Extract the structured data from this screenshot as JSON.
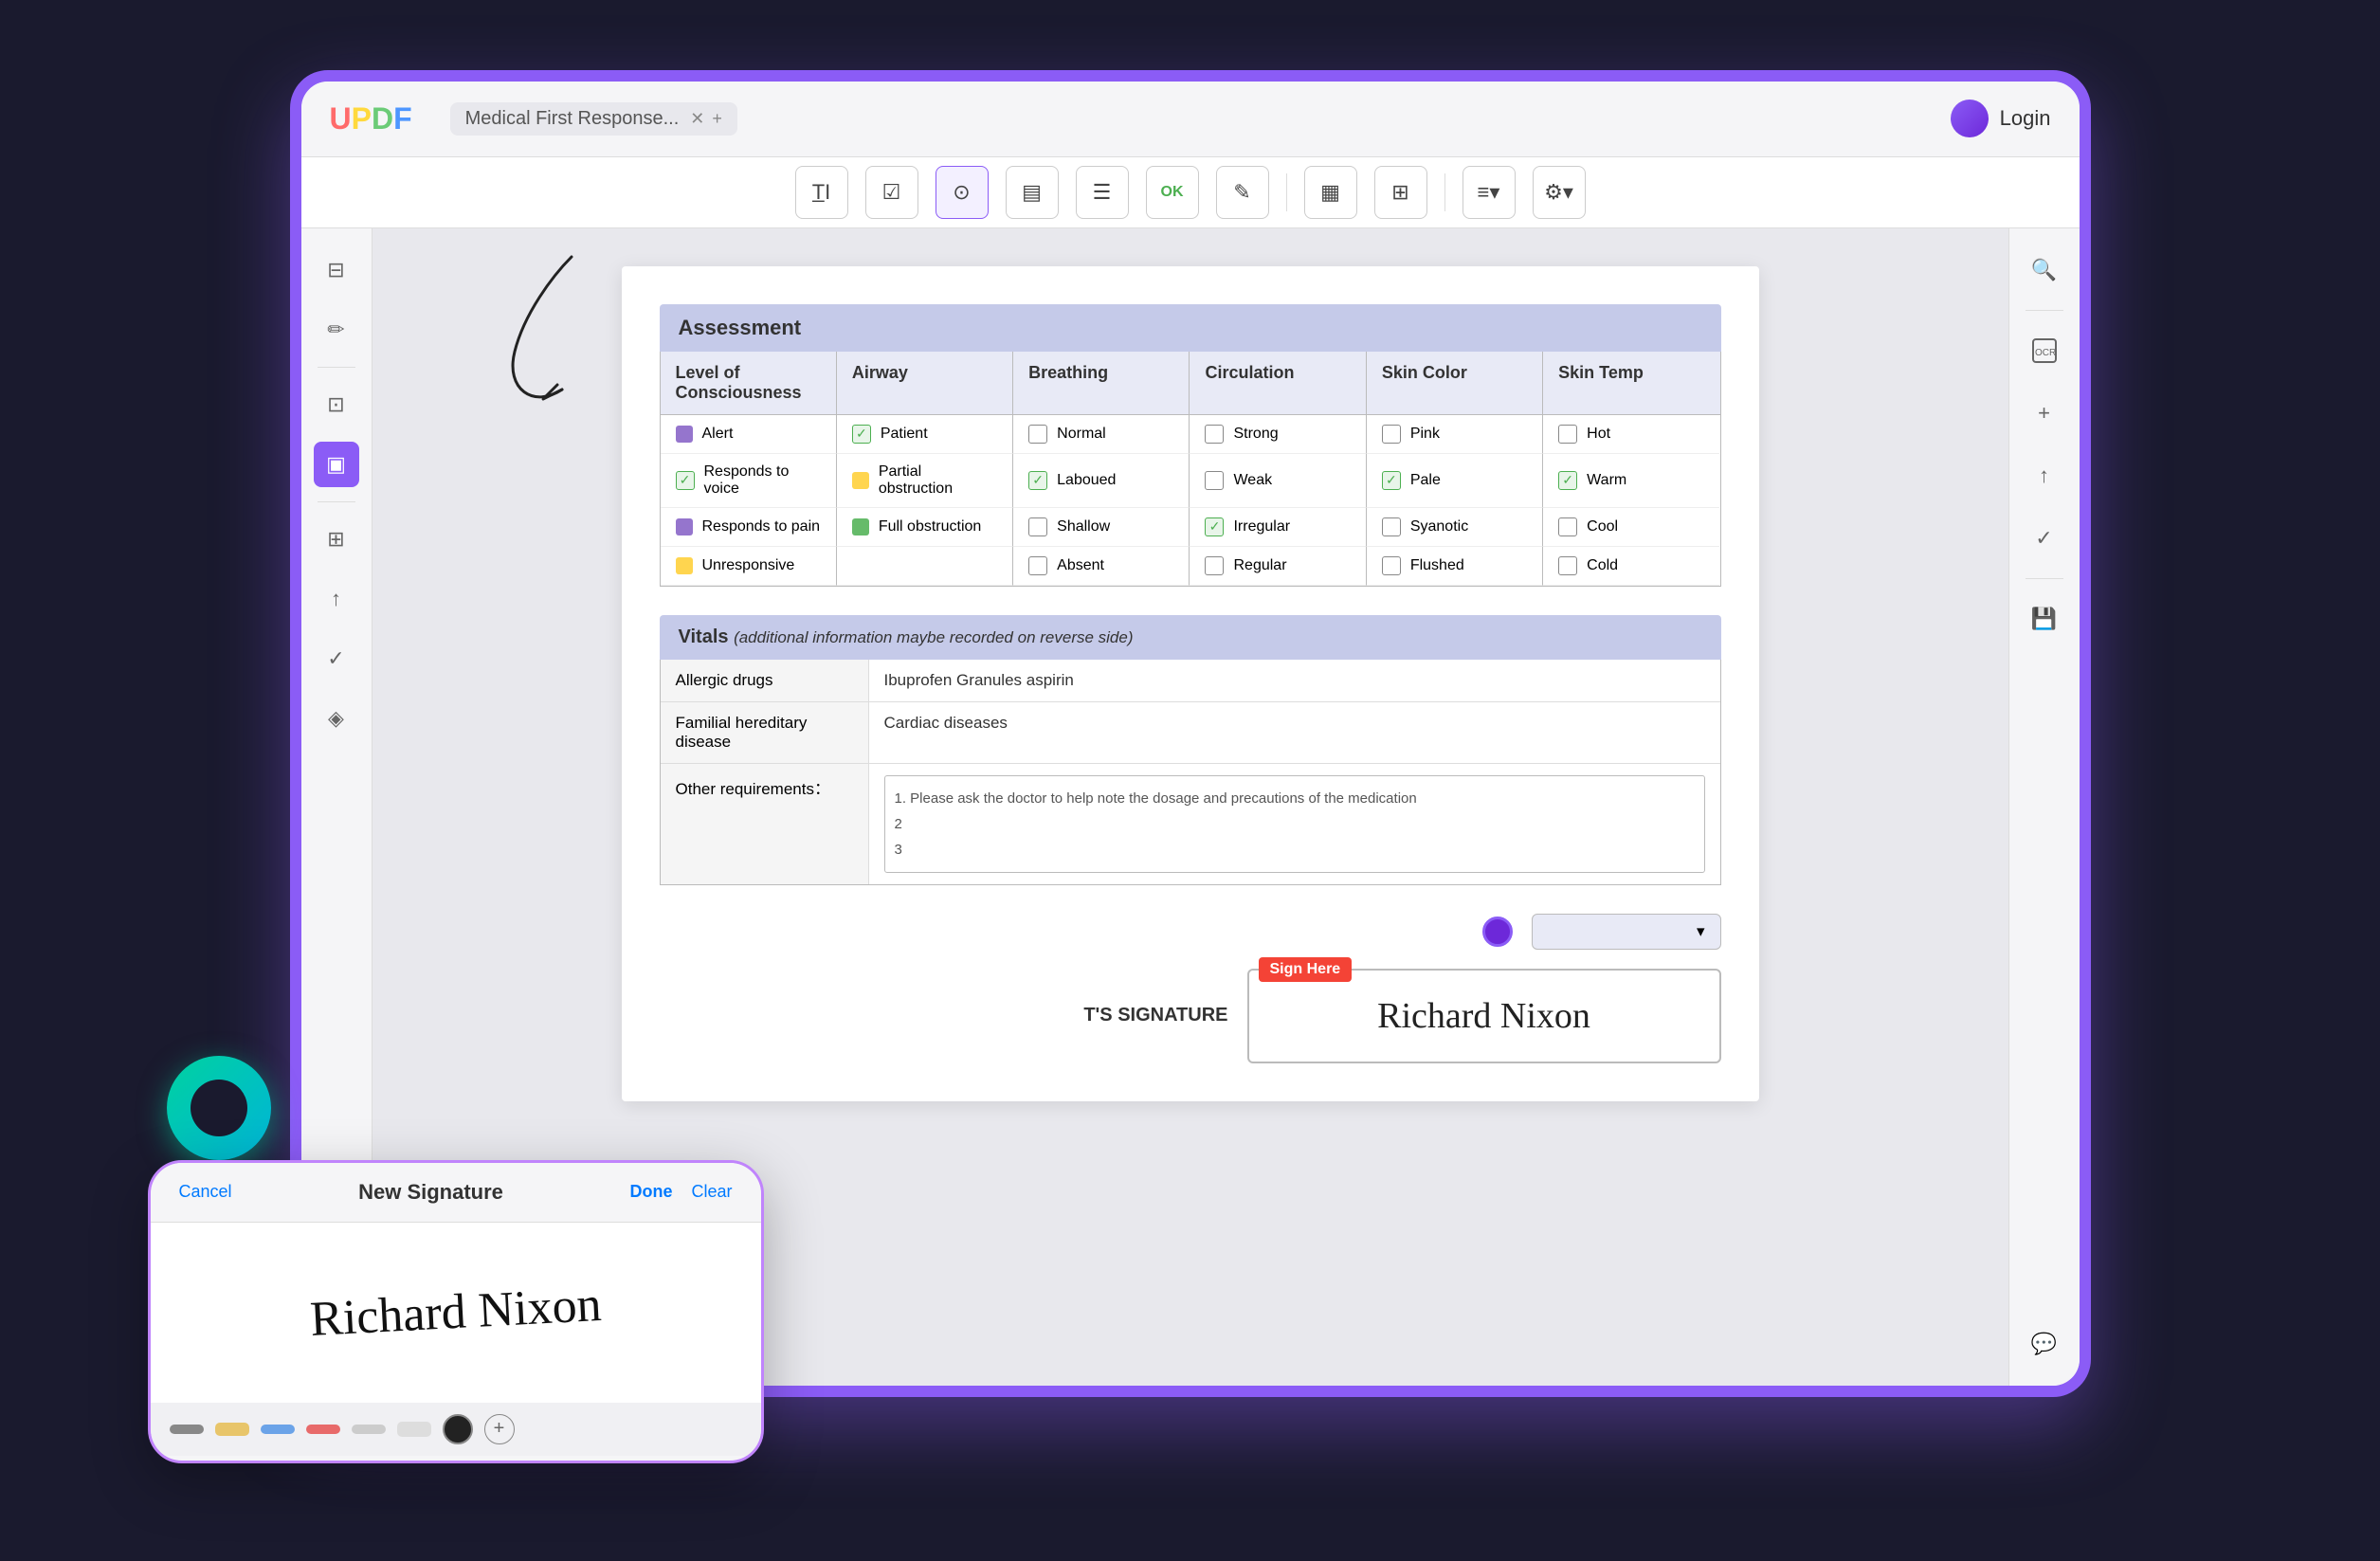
{
  "app": {
    "logo": "UPDF",
    "logo_letters": [
      "U",
      "P",
      "D",
      "F"
    ],
    "tab_title": "Medical First Response...",
    "login_label": "Login"
  },
  "toolbar": {
    "tools": [
      {
        "name": "text-field",
        "icon": "T̲I"
      },
      {
        "name": "checkbox-tool",
        "icon": "☑"
      },
      {
        "name": "radio-tool",
        "icon": "⊙"
      },
      {
        "name": "text-area",
        "icon": "▤"
      },
      {
        "name": "list-tool",
        "icon": "☰"
      },
      {
        "name": "ok-stamp",
        "icon": "OK"
      },
      {
        "name": "signature-tool",
        "icon": "✎"
      },
      {
        "name": "image-tool",
        "icon": "▦"
      },
      {
        "name": "grid-tool",
        "icon": "⊞"
      },
      {
        "name": "align-tool",
        "icon": "≡"
      },
      {
        "name": "settings-tool",
        "icon": "⚙"
      }
    ]
  },
  "sidebar": {
    "icons": [
      {
        "name": "pages",
        "icon": "⊟"
      },
      {
        "name": "edit",
        "icon": "✏"
      },
      {
        "name": "comment",
        "icon": "⊡"
      },
      {
        "name": "form",
        "icon": "▣"
      },
      {
        "name": "organize",
        "icon": "⊞"
      },
      {
        "name": "export",
        "icon": "↑"
      },
      {
        "name": "protect",
        "icon": "✓"
      },
      {
        "name": "watermark",
        "icon": "◈"
      }
    ]
  },
  "assessment": {
    "header": "Assessment",
    "columns": [
      "Level of Consciousness",
      "Airway",
      "Breathing",
      "Circulation",
      "Skin Color",
      "Skin Temp"
    ],
    "rows": [
      {
        "consciousness": {
          "label": "Alert",
          "checked": false,
          "color": "purple"
        },
        "airway": {
          "label": "Patient",
          "checked": true,
          "color": "green"
        },
        "breathing": {
          "label": "Normal",
          "checked": false
        },
        "circulation": {
          "label": "Strong",
          "checked": false
        },
        "skin_color": {
          "label": "Pink",
          "checked": false
        },
        "skin_temp": {
          "label": "Hot",
          "checked": false
        }
      },
      {
        "consciousness": {
          "label": "Responds to voice",
          "checked": true,
          "color": "yellow"
        },
        "airway": {
          "label": "Partial obstruction",
          "checked": false,
          "color": "yellow"
        },
        "breathing": {
          "label": "Laboued",
          "checked": true
        },
        "circulation": {
          "label": "Weak",
          "checked": false
        },
        "skin_color": {
          "label": "Pale",
          "checked": true
        },
        "skin_temp": {
          "label": "Warm",
          "checked": true
        }
      },
      {
        "consciousness": {
          "label": "Responds to pain",
          "checked": false,
          "color": "purple"
        },
        "airway": {
          "label": "Full obstruction",
          "checked": false,
          "color": "green"
        },
        "breathing": {
          "label": "Shallow",
          "checked": false
        },
        "circulation": {
          "label": "Irregular",
          "checked": true
        },
        "skin_color": {
          "label": "Syanotic",
          "checked": false
        },
        "skin_temp": {
          "label": "Cool",
          "checked": false
        }
      },
      {
        "consciousness": {
          "label": "Unresponsive",
          "checked": false,
          "color": "yellow"
        },
        "airway": {
          "label": "",
          "checked": false
        },
        "breathing": {
          "label": "Absent",
          "checked": false
        },
        "circulation": {
          "label": "Regular",
          "checked": false
        },
        "skin_color": {
          "label": "Flushed",
          "checked": false
        },
        "skin_temp": {
          "label": "Cold",
          "checked": false
        }
      }
    ]
  },
  "vitals": {
    "header": "Vitals",
    "subheader": "(additional information maybe recorded on reverse side)",
    "fields": [
      {
        "label": "Allergic drugs",
        "value": "Ibuprofen Granules  aspirin"
      },
      {
        "label": "Familial hereditary disease",
        "value": "Cardiac diseases"
      }
    ],
    "other_requirements_label": "Other requirements：",
    "other_requirements": [
      "1. Please ask the doctor to help note the dosage and precautions of the medication",
      "2",
      "3"
    ]
  },
  "signature": {
    "sign_here_label": "Sign Here",
    "signature_label": "T'S SIGNATURE",
    "signature_text": "Richard Nixon",
    "done_label": "Done",
    "clear_label": "Clear",
    "cancel_label": "Cancel",
    "new_signature_title": "New Signature"
  }
}
